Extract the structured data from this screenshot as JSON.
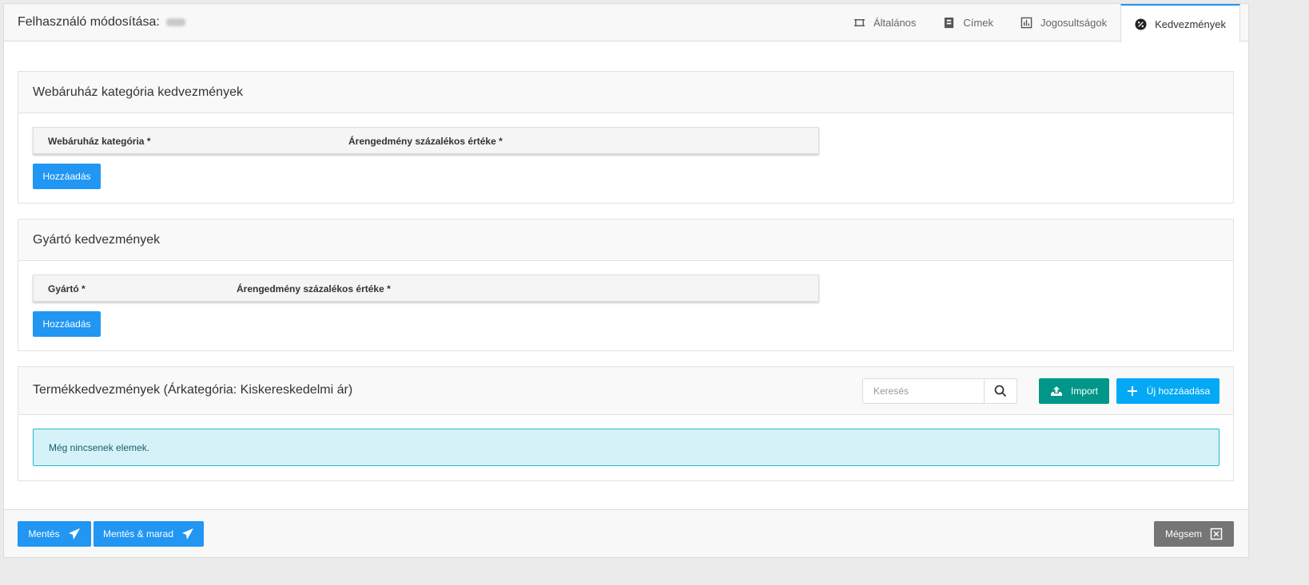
{
  "header": {
    "title": "Felhasználó módosítása:",
    "tabs": [
      {
        "label": "Általános",
        "icon": "frame-icon",
        "active": false
      },
      {
        "label": "Címek",
        "icon": "address-book-icon",
        "active": false
      },
      {
        "label": "Jogosultságok",
        "icon": "chart-icon",
        "active": false
      },
      {
        "label": "Kedvezmények",
        "icon": "percent-icon",
        "active": true
      }
    ]
  },
  "webshop_section": {
    "title": "Webáruház kategória kedvezmények",
    "col1": "Webáruház kategória *",
    "col2": "Árengedmény százalékos értéke *",
    "add_label": "Hozzáadás"
  },
  "manufacturer_section": {
    "title": "Gyártó kedvezmények",
    "col1": "Gyártó *",
    "col2": "Árengedmény százalékos értéke *",
    "add_label": "Hozzáadás"
  },
  "product_section": {
    "title": "Termékkedvezmények (Árkategória: Kiskereskedelmi ár)",
    "search_placeholder": "Keresés",
    "import_label": "Import",
    "new_label": "Új hozzáadása",
    "empty_text": "Még nincsenek elemek."
  },
  "footer": {
    "save_label": "Mentés",
    "save_stay_label": "Mentés & marad",
    "cancel_label": "Mégsem"
  },
  "colors": {
    "primary": "#2196f3",
    "teal": "#009688",
    "cyan": "#03a9f4",
    "grey": "#757575",
    "alert_bg": "#d4f2f7"
  }
}
